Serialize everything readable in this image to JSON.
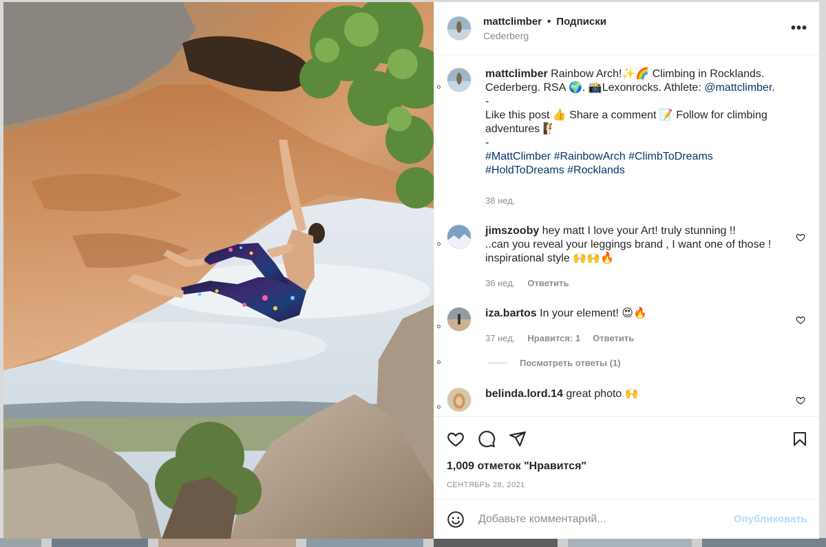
{
  "post": {
    "username": "mattclimber",
    "separator": "•",
    "follow_label": "Подписки",
    "location": "Cederberg",
    "more_label": "•••"
  },
  "caption": {
    "username": "mattclimber",
    "line1": " Rainbow Arch!✨🌈 Climbing in Rocklands.",
    "line2_prefix": "Cederberg. RSA 🌍. 📸Lexonrocks. Athlete: ",
    "line2_mention": "@mattclimber",
    "line2_suffix": ".",
    "dash1": "-",
    "line3": "Like this post 👍 Share a comment 📝 Follow for climbing",
    "line4": "adventures 🧗",
    "dash2": "-",
    "tags_line1": "#MattClimber #RainbowArch #ClimbToDreams",
    "tags_line2": "#HoldToDreams #Rocklands",
    "time": "38 нед."
  },
  "comments": [
    {
      "username": "jimszooby",
      "text_line1": " hey matt I love your Art! truly stunning !!",
      "text_line2": "..can you reveal your leggings brand , I want one of those !",
      "text_line3": "inspirational style 🙌🙌🔥",
      "time": "36 нед.",
      "reply": "Ответить"
    },
    {
      "username": "iza.bartos",
      "text_line1": " In your element! 😍🔥",
      "time": "37 нед.",
      "likes": "Нравится: 1",
      "reply": "Ответить",
      "view_replies": "Посмотреть ответы (1)"
    },
    {
      "username": "belinda.lord.14",
      "text_line1": " great photo 🙌"
    }
  ],
  "likes_text": "1,009 отметок \"Нравится\"",
  "date_text": "СЕНТЯБРЬ 28, 2021",
  "add_comment": {
    "placeholder": "Добавьте комментарий...",
    "publish": "Опубликовать"
  },
  "colors": {
    "link": "#00376b",
    "muted": "#8e8e8e",
    "publish_disabled": "#b3dbff"
  }
}
